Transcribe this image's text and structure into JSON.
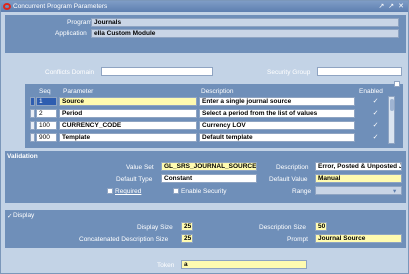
{
  "window": {
    "title": "Concurrent Program Parameters",
    "controls": "↗ ↗ ✕"
  },
  "program": {
    "label": "Program",
    "value": "Journals",
    "app_label": "Application",
    "app_value": "eIla Custom Module"
  },
  "conflicts": {
    "label": "Conflicts Domain",
    "value": "",
    "security_label": "Security Group",
    "security_value": ""
  },
  "table": {
    "headers": {
      "seq": "Seq",
      "parameter": "Parameter",
      "description": "Description",
      "enabled": "Enabled"
    },
    "rows": [
      {
        "seq": "1",
        "parameter": "Source",
        "description": "Enter a single journal source",
        "enabled": "✓"
      },
      {
        "seq": "2",
        "parameter": "Period",
        "description": "Select a period from the list of values",
        "enabled": "✓"
      },
      {
        "seq": "100",
        "parameter": "CURRENCY_CODE",
        "description": "Currency LOV",
        "enabled": "✓"
      },
      {
        "seq": "900",
        "parameter": "Template",
        "description": "Default template",
        "enabled": "✓"
      }
    ]
  },
  "validation": {
    "title": "Validation",
    "value_set_label": "Value Set",
    "value_set": "GL_SRS_JOURNAL_SOURCE",
    "description_label": "Description",
    "description": "Error, Posted & Unposted J",
    "default_type_label": "Default Type",
    "default_type": "Constant",
    "default_value_label": "Default Value",
    "default_value": "Manual",
    "required_label": "Required",
    "enable_security_label": "Enable Security",
    "range_label": "Range",
    "range_value": ""
  },
  "display": {
    "title": "Display",
    "check": "✓",
    "display_size_label": "Display Size",
    "display_size": "25",
    "desc_size_label": "Description Size",
    "desc_size": "50",
    "concat_label": "Concatenated Description Size",
    "concat_size": "25",
    "prompt_label": "Prompt",
    "prompt": "Journal Source"
  },
  "token": {
    "label": "Token",
    "value": "a"
  }
}
